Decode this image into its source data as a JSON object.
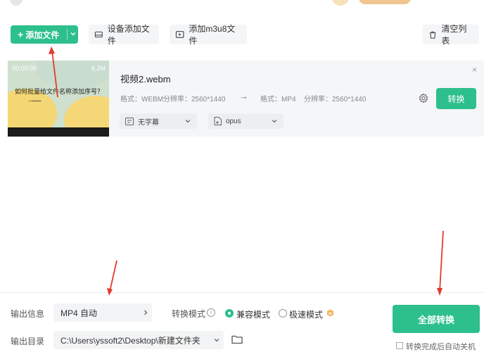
{
  "toolbar": {
    "add_file": "添加文件",
    "device_add": "设备添加文件",
    "add_m3u8": "添加m3u8文件",
    "clear_list": "清空列表"
  },
  "file": {
    "thumbnail": {
      "duration": "00:00:00",
      "size": "6.2M",
      "title": "如何批量给文件名称添加序号？"
    },
    "name": "视频2.webm",
    "source": {
      "format": "格式：WEBM",
      "resolution": "分辨率：2560*1440"
    },
    "target": {
      "format": "格式：MP4",
      "resolution": "分辨率：2560*1440"
    },
    "subtitle_select": "无字幕",
    "audio_select": "opus",
    "close": "×",
    "convert_button": "转换"
  },
  "bottom": {
    "output_info_label": "输出信息",
    "output_info_value": "MP4 自动",
    "mode_label": "转换模式",
    "mode_compatible": "兼容模式",
    "mode_fast": "极速模式",
    "output_dir_label": "输出目录",
    "output_dir_value": "C:\\Users\\yssoft2\\Desktop\\新建文件夹",
    "convert_all": "全部转换",
    "shutdown_label": "转换完成后自动关机",
    "mode_selected": "兼容模式"
  },
  "colors": {
    "accent": "#2dbf8c",
    "annotation": "#e23b2e"
  }
}
